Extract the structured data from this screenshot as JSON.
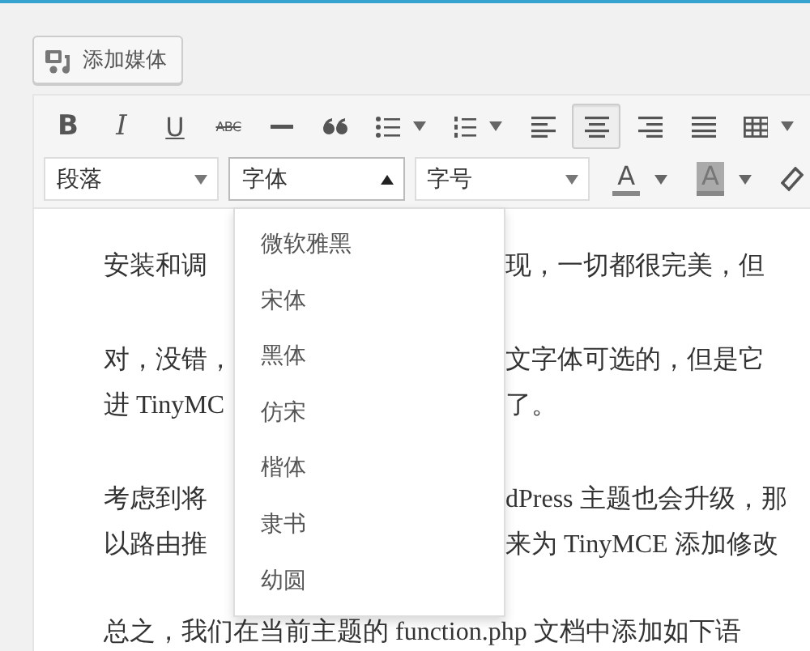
{
  "add_media_button": {
    "label": "添加媒体"
  },
  "toolbar": {
    "row1": [
      {
        "kind": "bold",
        "label": "B",
        "selected": false
      },
      {
        "kind": "italic",
        "label": "I",
        "selected": false
      },
      {
        "kind": "underline",
        "label": "U",
        "selected": false
      },
      {
        "kind": "strike",
        "label": "ABC",
        "selected": false
      },
      {
        "kind": "hr",
        "selected": false
      },
      {
        "kind": "quote",
        "selected": false
      },
      {
        "kind": "bullets",
        "selected": false,
        "dropdown": true
      },
      {
        "kind": "numbers",
        "selected": false,
        "dropdown": true
      },
      {
        "kind": "align-left",
        "selected": false
      },
      {
        "kind": "align-center",
        "selected": true
      },
      {
        "kind": "align-right",
        "selected": false
      },
      {
        "kind": "justify",
        "selected": false
      },
      {
        "kind": "table",
        "selected": false,
        "dropdown": true
      }
    ],
    "selects": [
      {
        "label": "段落",
        "open": false
      },
      {
        "label": "字体",
        "open": true
      },
      {
        "label": "字号",
        "open": false
      }
    ],
    "row2": [
      {
        "kind": "text-color",
        "label": "A",
        "dropdown": true
      },
      {
        "kind": "background-color",
        "label": "A",
        "dropdown": true
      },
      {
        "kind": "eraser"
      }
    ]
  },
  "font_menu": {
    "items": [
      "微软雅黑",
      "宋体",
      "黑体",
      "仿宋",
      "楷体",
      "隶书",
      "幼圆"
    ]
  },
  "content": {
    "paragraphs": [
      {
        "lines": [
          {
            "left": "安装和调",
            "right": "现，一切都很完美，但"
          }
        ]
      },
      {
        "lines": [
          {
            "left": "对，没错，",
            "right": "文字体可选的，但是它"
          },
          {
            "left": "进 TinyMC",
            "right": "了。"
          }
        ]
      },
      {
        "lines": [
          {
            "left": "考虑到将",
            "right": "dPress 主题也会升级，那"
          },
          {
            "left": "以路由推",
            "right": "来为 TinyMCE 添加修改"
          }
        ]
      },
      {
        "lines": [
          {
            "full": "总之，我们在当前主题的 function.php 文档中添加如下语"
          }
        ]
      }
    ]
  }
}
